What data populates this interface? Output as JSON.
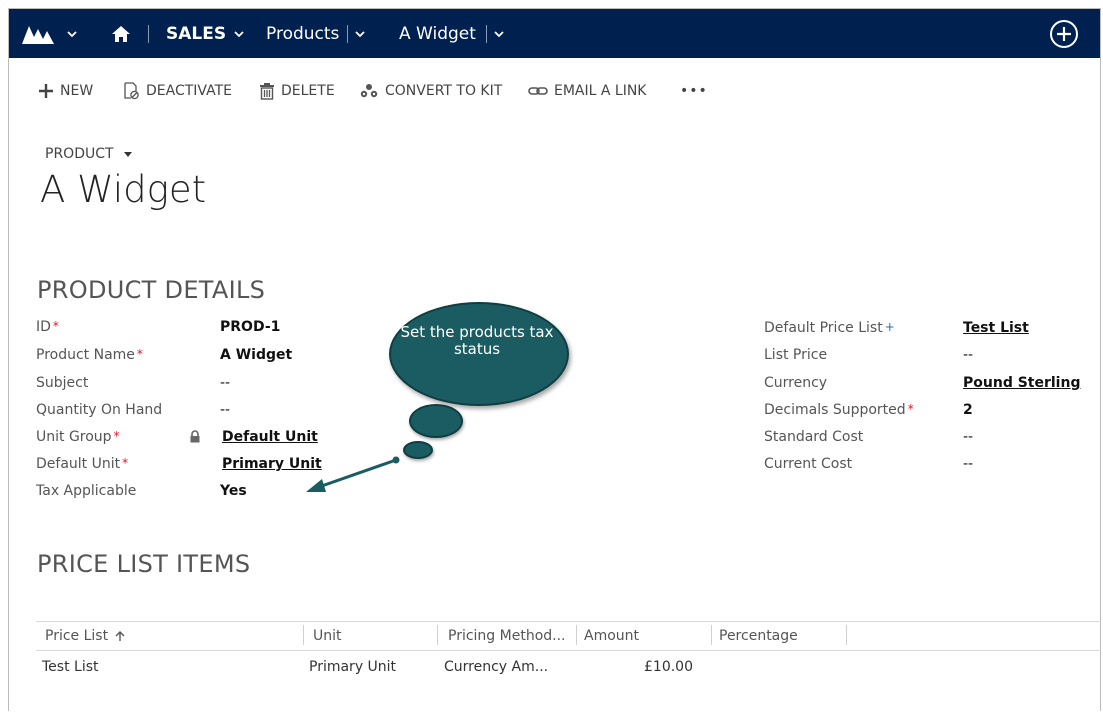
{
  "nav": {
    "area": "SALES",
    "entity": "Products",
    "record": "A Widget"
  },
  "commands": {
    "new": "NEW",
    "deactivate": "DEACTIVATE",
    "delete": "DELETE",
    "convert": "CONVERT TO KIT",
    "email": "EMAIL A LINK",
    "more": "•••"
  },
  "header": {
    "entity_type": "PRODUCT",
    "title": "A Widget"
  },
  "details": {
    "section_title": "PRODUCT DETAILS",
    "left": [
      {
        "label": "ID",
        "required": "*",
        "value": "PROD-1"
      },
      {
        "label": "Product Name",
        "required": "*",
        "value": "A Widget"
      },
      {
        "label": "Subject",
        "value": "--"
      },
      {
        "label": "Quantity On Hand",
        "value": "--"
      },
      {
        "label": "Unit Group",
        "required": "*",
        "value": "Default Unit"
      },
      {
        "label": "Default Unit",
        "required": "*",
        "value": "Primary Unit"
      },
      {
        "label": "Tax Applicable",
        "value": "Yes"
      }
    ],
    "right": [
      {
        "label": "Default Price List",
        "recommended": "+",
        "value": "Test List"
      },
      {
        "label": "List Price",
        "value": "--"
      },
      {
        "label": "Currency",
        "value": "Pound Sterling"
      },
      {
        "label": "Decimals Supported",
        "required": "*",
        "value": "2"
      },
      {
        "label": "Standard Cost",
        "value": "--"
      },
      {
        "label": "Current Cost",
        "value": "--"
      }
    ]
  },
  "callout": {
    "text": "Set the products tax status",
    "color": "#1b5c63"
  },
  "price_list": {
    "section_title": "PRICE LIST ITEMS",
    "columns": [
      "Price List",
      "Unit",
      "Pricing Method...",
      "Amount",
      "Percentage"
    ],
    "rows": [
      [
        "Test List",
        "Primary Unit",
        "Currency Am...",
        "£10.00",
        ""
      ]
    ]
  },
  "colors": {
    "navbar": "#002050",
    "required": "#e81123",
    "recommended": "#1f6cc8"
  }
}
